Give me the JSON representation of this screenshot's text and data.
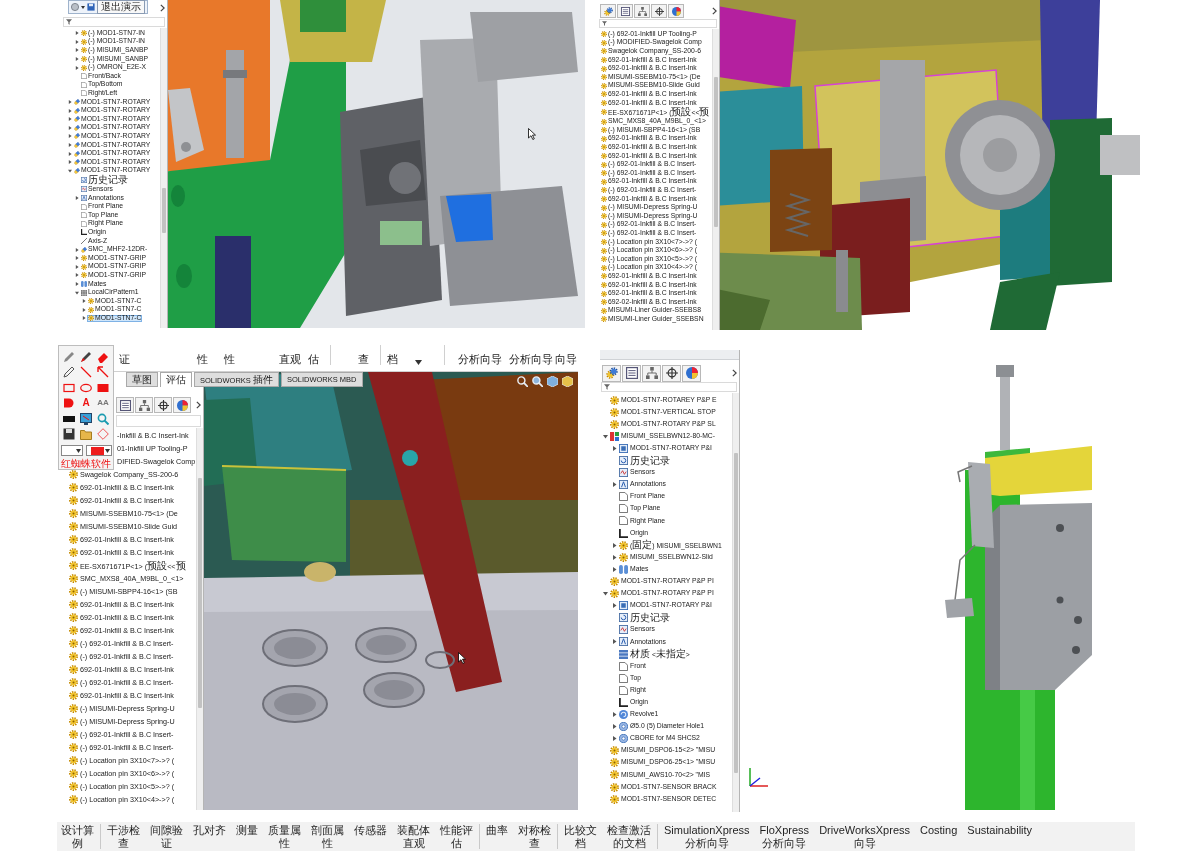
{
  "view_top_left": {
    "popup": {
      "button": "退出演示"
    },
    "tree": {
      "items": [
        {
          "children": [
            {
              "label": "(-) MOD1-STN7-IN",
              "kind": "part",
              "expanded": false,
              "selected": false
            },
            {
              "label": "(-) MOD1-STN7-IN",
              "kind": "part",
              "expanded": false,
              "selected": false
            },
            {
              "label": "(-) MISUMI_SANBP",
              "kind": "part",
              "expanded": false,
              "selected": false
            },
            {
              "label": "(-) MISUMI_SANBP",
              "kind": "part",
              "expanded": false,
              "selected": false
            },
            {
              "label": "(-) OMRON_E2E-X",
              "kind": "part",
              "expanded": false,
              "selected": false
            },
            {
              "label": "Front/Back",
              "kind": "plane",
              "selected": false
            },
            {
              "label": "Top/Bottom",
              "kind": "plane",
              "selected": false
            },
            {
              "label": "Right/Left",
              "kind": "plane",
              "selected": false
            }
          ]
        },
        {
          "label": "MOD1-STN7-ROTARY",
          "kind": "assembly",
          "expanded": false,
          "selected": false
        },
        {
          "label": "MOD1-STN7-ROTARY",
          "kind": "assembly",
          "expanded": false,
          "selected": false
        },
        {
          "label": "MOD1-STN7-ROTARY",
          "kind": "assembly",
          "expanded": false,
          "selected": false
        },
        {
          "label": "MOD1-STN7-ROTARY",
          "kind": "assembly",
          "expanded": false,
          "selected": false
        },
        {
          "label": "MOD1-STN7-ROTARY",
          "kind": "assembly",
          "expanded": false,
          "selected": false
        },
        {
          "label": "MOD1-STN7-ROTARY",
          "kind": "assembly",
          "expanded": false,
          "selected": false
        },
        {
          "label": "MOD1-STN7-ROTARY",
          "kind": "assembly",
          "expanded": false,
          "selected": false
        },
        {
          "label": "MOD1-STN7-ROTARY",
          "kind": "assembly",
          "expanded": false,
          "selected": false
        },
        {
          "label": "MOD1-STN7-ROTARY",
          "kind": "assembly",
          "expanded": true,
          "selected": false,
          "children": [
            {
              "label": "历史记录",
              "kind": "history",
              "selected": false
            },
            {
              "label": "Sensors",
              "kind": "sensors",
              "selected": false
            },
            {
              "label": "Annotations",
              "kind": "annotations",
              "expanded": false,
              "selected": false
            },
            {
              "label": "Front Plane",
              "kind": "plane",
              "selected": false
            },
            {
              "label": "Top Plane",
              "kind": "plane",
              "selected": false
            },
            {
              "label": "Right Plane",
              "kind": "plane",
              "selected": false
            },
            {
              "label": "Origin",
              "kind": "origin",
              "selected": false
            },
            {
              "label": "Axis-Z",
              "kind": "axis",
              "selected": false
            },
            {
              "label": "SMC_MHF2-12DR-",
              "kind": "assembly",
              "expanded": false,
              "selected": false
            },
            {
              "label": "MOD1-STN7-GRIP",
              "kind": "part",
              "expanded": false,
              "selected": false
            },
            {
              "label": "MOD1-STN7-GRIP",
              "kind": "part",
              "expanded": false,
              "selected": false
            },
            {
              "label": "MOD1-STN7-GRIP",
              "kind": "part",
              "expanded": false,
              "selected": false
            },
            {
              "label": "Mates",
              "kind": "mates",
              "expanded": false,
              "selected": false
            },
            {
              "label": "LocalCirPattern1",
              "kind": "pattern",
              "expanded": true,
              "selected": false,
              "children": [
                {
                  "label": "MOD1-STN7-C",
                  "expanded": false,
                  "selected": false
                },
                {
                  "label": "MOD1-STN7-C",
                  "expanded": false,
                  "selected": false
                },
                {
                  "label": "MOD1-STN7-C",
                  "expanded": false,
                  "selected": true
                }
              ]
            }
          ]
        }
      ]
    }
  },
  "view_top_right": {
    "tree": {
      "items": [
        {
          "label": "(-) 692-01-Inkfill UP Tooling-P"
        },
        {
          "label": "(-) MODIFIED-Swagelok Comp"
        },
        {
          "label": "Swagelok Company_SS-200-6"
        },
        {
          "label": "692-01-Inkfill & B.C Insert-Ink"
        },
        {
          "label": "692-01-Inkfill & B.C Insert-Ink"
        },
        {
          "label": "MISUMI-SSEBM10-75<1> (De"
        },
        {
          "label": "MISUMI-SSEBM10-Slide Guid"
        },
        {
          "label": "692-01-Inkfill & B.C Insert-Ink"
        },
        {
          "label": "692-01-Inkfill & B.C Insert-Ink"
        },
        {
          "label": "EE-SX671671P<1> (预設<<预"
        },
        {
          "label": "SMC_MXS8_40A_M9BL_0_<1>"
        },
        {
          "label": "(-) MISUMI-SBPP4-16<1> (SB"
        },
        {
          "label": "692-01-Inkfill & B.C Insert-Ink"
        },
        {
          "label": "692-01-Inkfill & B.C Insert-Ink"
        },
        {
          "label": "692-01-Inkfill & B.C Insert-Ink"
        },
        {
          "label": "(-) 692-01-Inkfill & B.C Insert-"
        },
        {
          "label": "(-) 692-01-Inkfill & B.C Insert-"
        },
        {
          "label": "692-01-Inkfill & B.C Insert-Ink"
        },
        {
          "label": "(-) 692-01-Inkfill & B.C Insert-"
        },
        {
          "label": "692-01-Inkfill & B.C Insert-Ink"
        },
        {
          "label": "(-) MISUMI-Depress Spring-U"
        },
        {
          "label": "(-) MISUMI-Depress Spring-U"
        },
        {
          "label": "(-) 692-01-Inkfill & B.C Insert-"
        },
        {
          "label": "(-) 692-01-Inkfill & B.C Insert-"
        },
        {
          "label": "(-) Location pin 3X10<7>->? ("
        },
        {
          "label": "(-) Location pin 3X10<6>->? ("
        },
        {
          "label": "(-) Location pin 3X10<5>->? ("
        },
        {
          "label": "(-) Location pin 3X10<4>->? ("
        },
        {
          "label": "692-01-Inkfill & B.C Insert-Ink"
        },
        {
          "label": "692-01-Inkfill & B.C Insert-Ink"
        },
        {
          "label": "692-01-Inkfill & B.C Insert-Ink"
        },
        {
          "label": "692-02-Inkfill & B.C Insert-Ink"
        },
        {
          "label": "MISUMI-Liner Guider-SSEBS8"
        },
        {
          "label": "MISUMI-Liner Guider_SSEBSN"
        }
      ]
    }
  },
  "view_bottom_left": {
    "ribbon_labels": [
      "证",
      "性",
      "性",
      "直观",
      "估",
      "查",
      "档",
      "分析向导",
      "分析向导",
      "向导"
    ],
    "tabs": [
      {
        "label": "草图",
        "selected": false
      },
      {
        "label": "评估",
        "selected": true
      },
      {
        "label": "SOLIDWORKS 插件",
        "selected": false
      },
      {
        "label": "SOLIDWORKS MBD",
        "selected": false
      }
    ],
    "palette": {
      "glyph_tools": [
        "A",
        "AA"
      ],
      "title": "红蜘蛛软件"
    },
    "tree": {
      "items": [
        {
          "label": "-Inkfill & B.C Insert-Ink"
        },
        {
          "label": "01-Inkfill UP Tooling-P"
        },
        {
          "label": "DIFIED-Swagelok Comp"
        },
        {
          "label": "Swagelok Company_SS-200-6"
        },
        {
          "label": "692-01-Inkfill & B.C Insert-Ink"
        },
        {
          "label": "692-01-Inkfill & B.C Insert-Ink"
        },
        {
          "label": "MISUMI-SSEBM10-75<1> (De"
        },
        {
          "label": "MISUMI-SSEBM10-Slide Guid"
        },
        {
          "label": "692-01-Inkfill & B.C Insert-Ink"
        },
        {
          "label": "692-01-Inkfill & B.C Insert-Ink"
        },
        {
          "label": "EE-SX671671P<1> (预設<<预"
        },
        {
          "label": "SMC_MXS8_40A_M9BL_0_<1>"
        },
        {
          "label": "(-) MISUMI-SBPP4-16<1> (SB"
        },
        {
          "label": "692-01-Inkfill & B.C Insert-Ink"
        },
        {
          "label": "692-01-Inkfill & B.C Insert-Ink"
        },
        {
          "label": "692-01-Inkfill & B.C Insert-Ink"
        },
        {
          "label": "(-) 692-01-Inkfill & B.C Insert-"
        },
        {
          "label": "(-) 692-01-Inkfill & B.C Insert-"
        },
        {
          "label": "692-01-Inkfill & B.C Insert-Ink"
        },
        {
          "label": "(-) 692-01-Inkfill & B.C Insert-"
        },
        {
          "label": "692-01-Inkfill & B.C Insert-Ink"
        },
        {
          "label": "(-) MISUMI-Depress Spring-U"
        },
        {
          "label": "(-) MISUMI-Depress Spring-U"
        },
        {
          "label": "(-) 692-01-Inkfill & B.C Insert-"
        },
        {
          "label": "(-) 692-01-Inkfill & B.C Insert-"
        },
        {
          "label": "(-) Location pin 3X10<7>->? ("
        },
        {
          "label": "(-) Location pin 3X10<6>->? ("
        },
        {
          "label": "(-) Location pin 3X10<5>->? ("
        },
        {
          "label": "(-) Location pin 3X10<4>->? ("
        }
      ]
    }
  },
  "view_bottom_right": {
    "tree": {
      "items": [
        {
          "label": "MOD1-STN7-ROTAREY P&P E",
          "kind": "part"
        },
        {
          "label": "MOD1-STN7-VERTICAL STOP",
          "kind": "part"
        },
        {
          "label": "MOD1-STN7-ROTARY P&P SL",
          "kind": "part"
        },
        {
          "label": "MISUMI_SSELBWN12-80-MC-",
          "kind": "subassembly",
          "expanded": true,
          "children": [
            {
              "label": "MOD1-STN7-ROTARY P&I",
              "kind": "feature",
              "expanded": false
            },
            {
              "label": "历史记录",
              "kind": "history"
            },
            {
              "label": "Sensors",
              "kind": "sensors"
            },
            {
              "label": "Annotations",
              "kind": "annotations",
              "expanded": false
            },
            {
              "label": "Front Plane",
              "kind": "plane"
            },
            {
              "label": "Top Plane",
              "kind": "plane"
            },
            {
              "label": "Right Plane",
              "kind": "plane"
            },
            {
              "label": "Origin",
              "kind": "origin"
            },
            {
              "label": "(固定) MISUMI_SSELBWN1",
              "kind": "part",
              "expanded": false
            },
            {
              "label": "MISUMI_SSELBWN12-Slid",
              "kind": "part",
              "expanded": false
            },
            {
              "label": "Mates",
              "kind": "mates",
              "expanded": false
            }
          ]
        },
        {
          "label": "MOD1-STN7-ROTARY P&P PI",
          "kind": "part"
        },
        {
          "label": "MOD1-STN7-ROTARY P&P PI",
          "kind": "part",
          "expanded": true,
          "children": [
            {
              "label": "MOD1-STN7-ROTARY P&I",
              "kind": "feature",
              "expanded": false
            },
            {
              "label": "历史记录",
              "kind": "history"
            },
            {
              "label": "Sensors",
              "kind": "sensors"
            },
            {
              "label": "Annotations",
              "kind": "annotations",
              "expanded": false
            },
            {
              "label": "材质 <未指定>",
              "kind": "material"
            },
            {
              "label": "Front",
              "kind": "plane"
            },
            {
              "label": "Top",
              "kind": "plane"
            },
            {
              "label": "Right",
              "kind": "plane"
            },
            {
              "label": "Origin",
              "kind": "origin"
            },
            {
              "label": "Revolve1",
              "kind": "revolve",
              "expanded": false
            },
            {
              "label": "Ø5.0 (5) Diameter Hole1",
              "kind": "hole",
              "expanded": false
            },
            {
              "label": "CBORE for M4 SHCS2",
              "kind": "hole",
              "expanded": false
            }
          ]
        },
        {
          "label": "MISUMI_DSPO6-15<2> \"MISU",
          "kind": "part"
        },
        {
          "label": "MISUMI_DSPO6-25<1> \"MISU",
          "kind": "part"
        },
        {
          "label": "MISUMI_AWS10-70<2> \"MIS",
          "kind": "part"
        },
        {
          "label": "MOD1-STN7-SENSOR BRACK",
          "kind": "part"
        },
        {
          "label": "MOD1-STN7-SENSOR DETEC",
          "kind": "part"
        }
      ]
    }
  },
  "evaluate_toolbar": {
    "groups": [
      {
        "buttons": [
          "设计算例"
        ]
      },
      {
        "buttons": [
          "干涉检查",
          "间隙验证",
          "孔对齐",
          "测量",
          "质量属性",
          "剖面属性",
          "传感器",
          "装配体直观",
          "性能评估"
        ]
      },
      {
        "buttons": [
          "曲率",
          "对称检查"
        ]
      },
      {
        "buttons": [
          "比较文档",
          "检查激活的文档"
        ]
      },
      {
        "buttons": [
          "SimulationXpress 分析向导",
          "FloXpress 分析向导",
          "DriveWorksXpress 向导",
          "Costing",
          "Sustainability"
        ]
      }
    ]
  }
}
